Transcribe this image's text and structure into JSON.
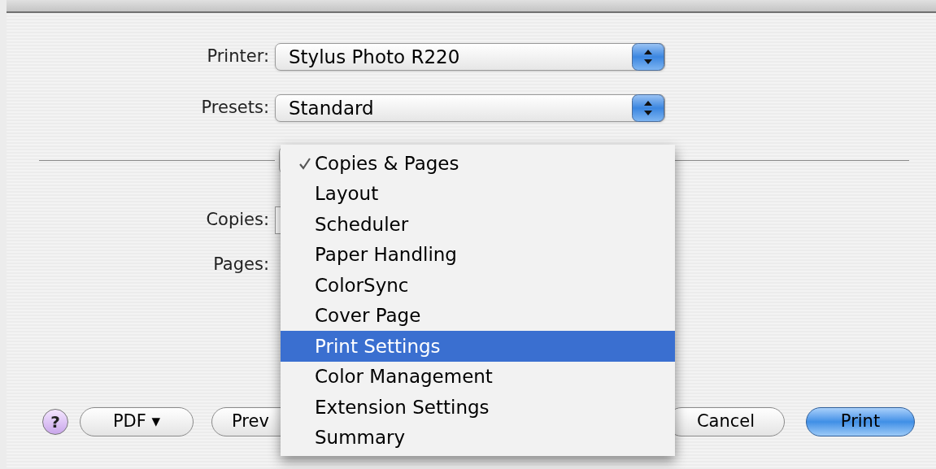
{
  "printer": {
    "label": "Printer:",
    "value": "Stylus Photo R220"
  },
  "presets": {
    "label": "Presets:",
    "value": "Standard"
  },
  "copies": {
    "label": "Copies:"
  },
  "pages": {
    "label": "Pages:"
  },
  "menu": [
    {
      "label": "Copies & Pages",
      "checked": true,
      "selected": false
    },
    {
      "label": "Layout",
      "checked": false,
      "selected": false
    },
    {
      "label": "Scheduler",
      "checked": false,
      "selected": false
    },
    {
      "label": "Paper Handling",
      "checked": false,
      "selected": false
    },
    {
      "label": "ColorSync",
      "checked": false,
      "selected": false
    },
    {
      "label": "Cover Page",
      "checked": false,
      "selected": false
    },
    {
      "label": "Print Settings",
      "checked": false,
      "selected": true
    },
    {
      "label": "Color Management",
      "checked": false,
      "selected": false
    },
    {
      "label": "Extension Settings",
      "checked": false,
      "selected": false
    },
    {
      "label": "Summary",
      "checked": false,
      "selected": false
    }
  ],
  "buttons": {
    "help": "?",
    "pdf": "PDF ▾",
    "preview": "Prev",
    "cancel": "Cancel",
    "print": "Print"
  }
}
